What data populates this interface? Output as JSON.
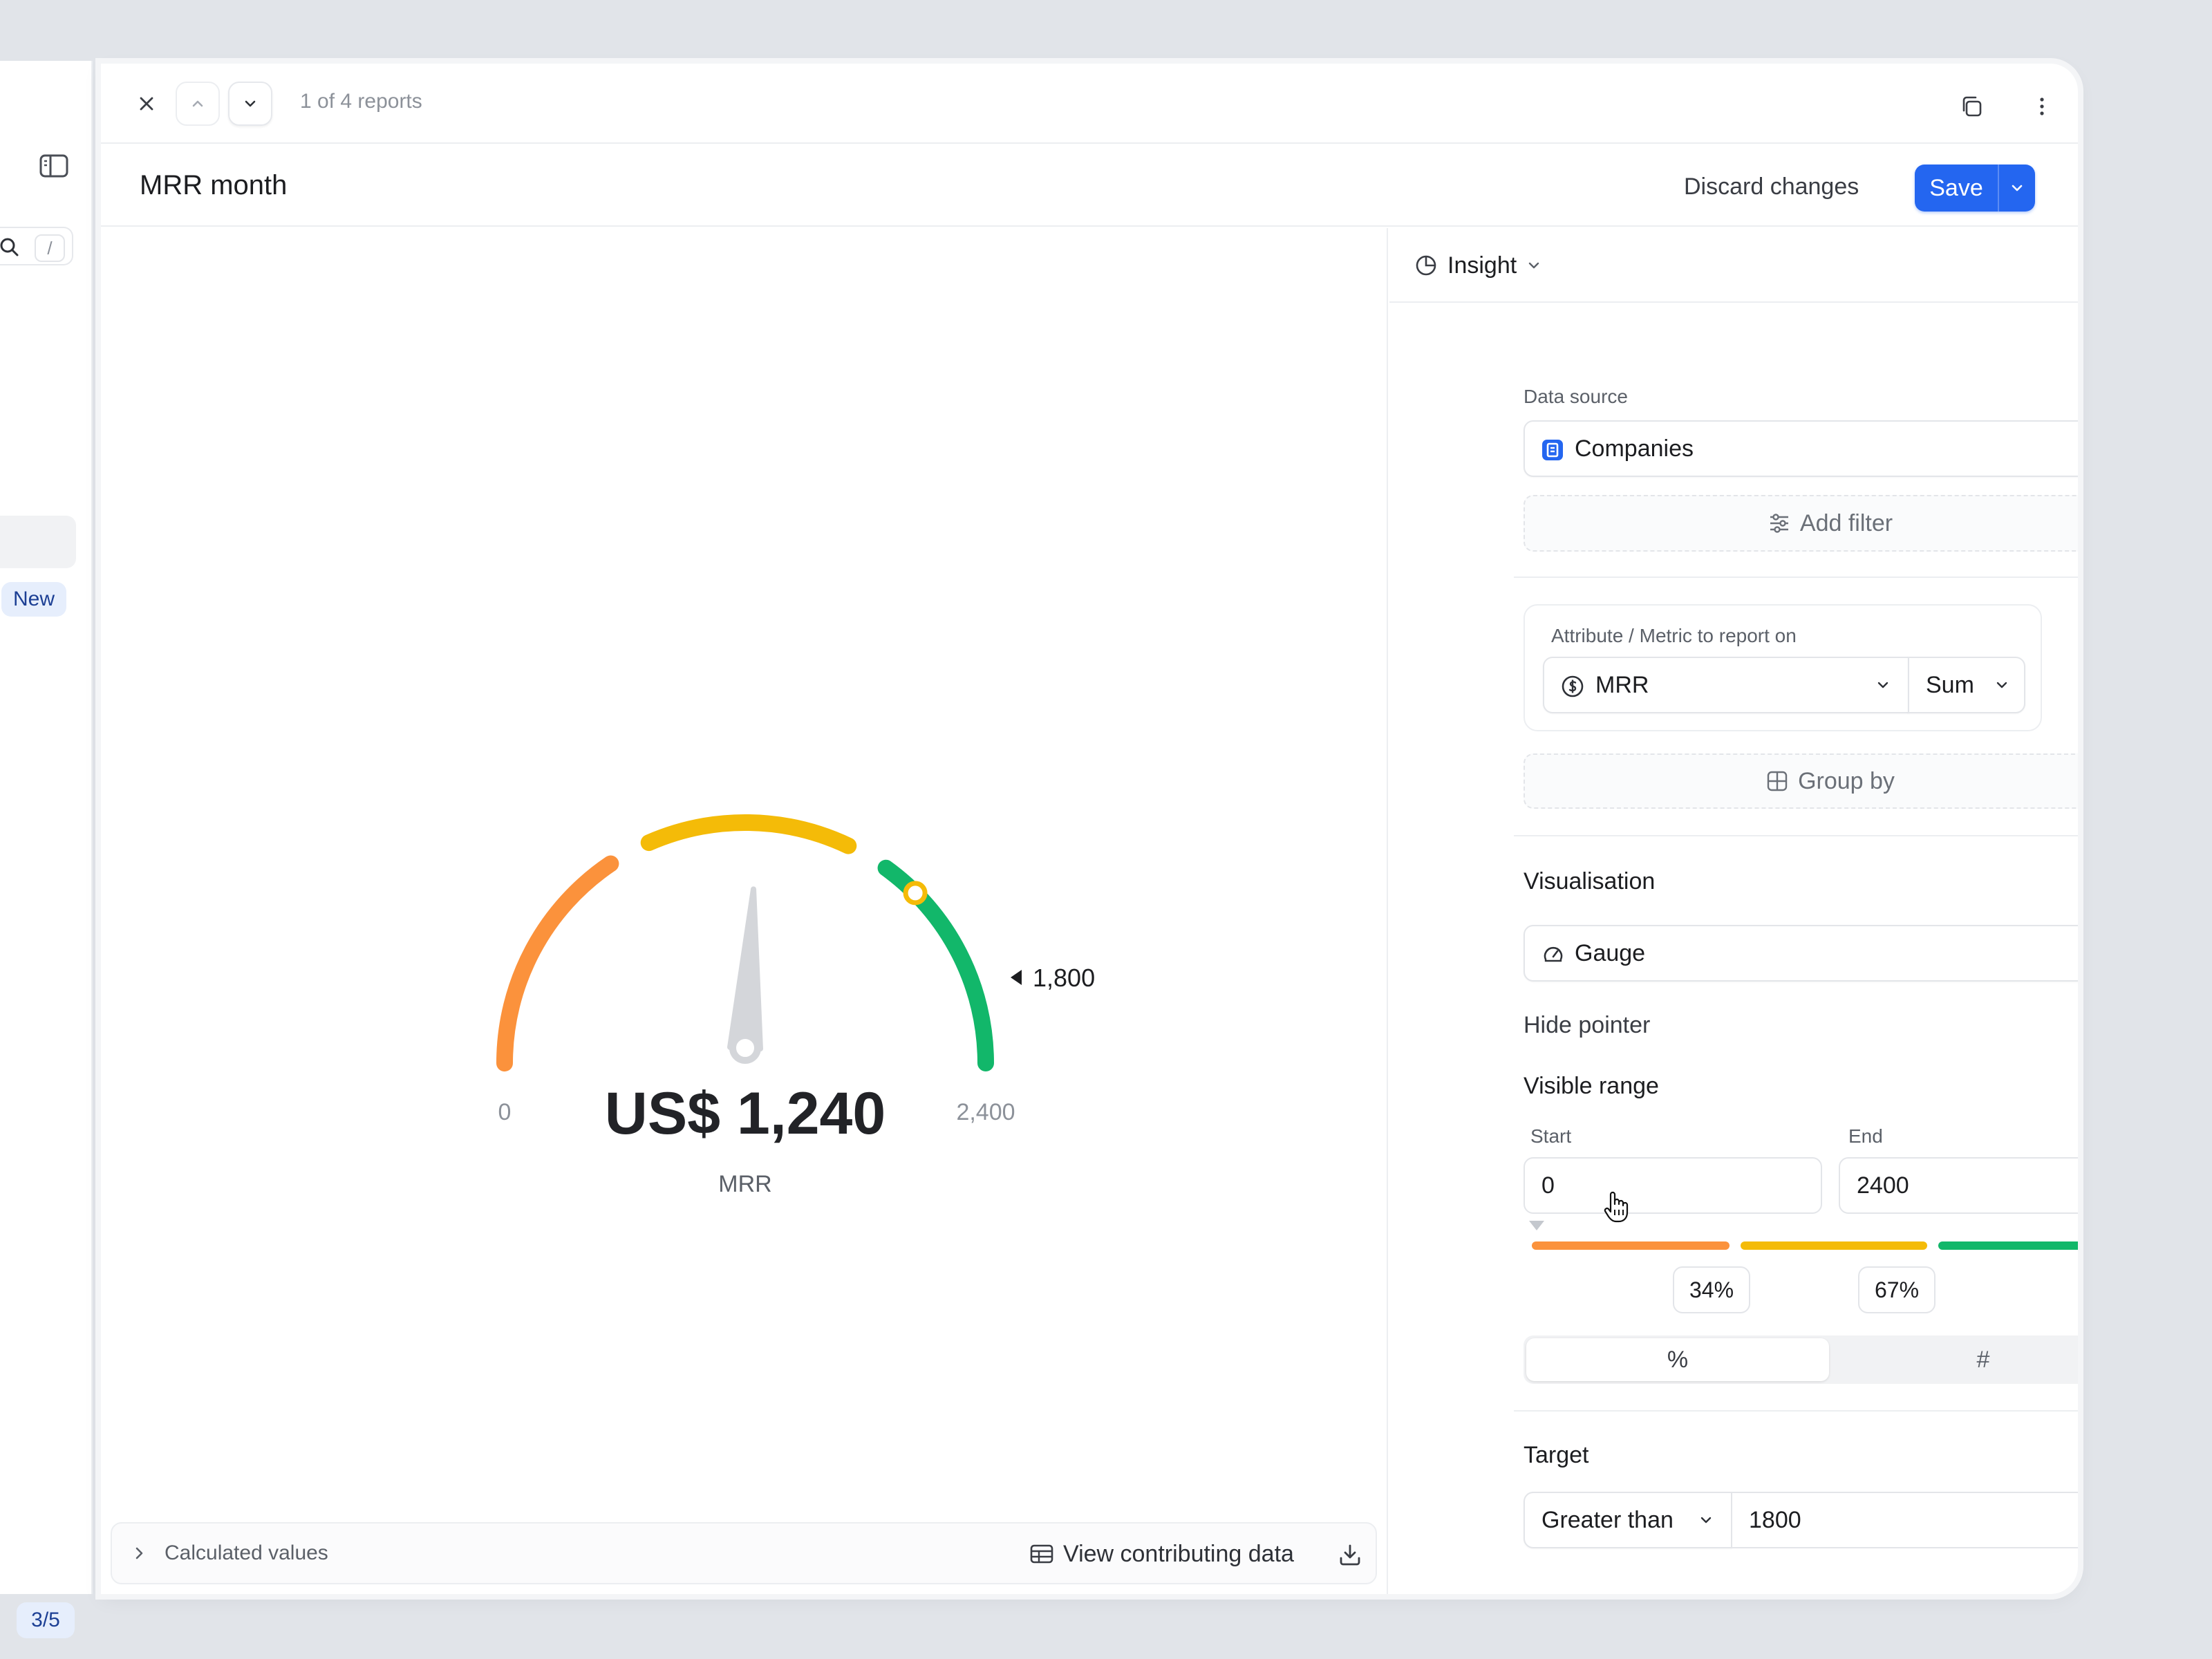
{
  "sidebar": {
    "search_shortcut": "/",
    "new_badge": "New",
    "pager": "3/5"
  },
  "topbar": {
    "report_count": "1 of 4 reports"
  },
  "header": {
    "title": "MRR month",
    "discard_label": "Discard changes",
    "save_label": "Save"
  },
  "gauge": {
    "value_display": "US$ 1,240",
    "metric_label": "MRR",
    "min_label": "0",
    "max_label": "2,400",
    "target_label": "1,800",
    "value": 1240,
    "min": 0,
    "max": 2400,
    "target": 1800,
    "thresholds_pct": [
      34,
      67
    ],
    "colors": {
      "low": "#fb923c",
      "mid": "#f4bb08",
      "high": "#12b76a",
      "needle": "#d4d6da"
    }
  },
  "footer": {
    "calculated_values": "Calculated values",
    "view_data": "View contributing data"
  },
  "panel": {
    "mode_label": "Insight",
    "data_source_label": "Data source",
    "data_source_value": "Companies",
    "add_filter": "Add filter",
    "metric_section_label": "Attribute / Metric to report on",
    "metric_value": "MRR",
    "aggregation_value": "Sum",
    "group_by": "Group by",
    "visualisation_title": "Visualisation",
    "visualisation_value": "Gauge",
    "hide_pointer_label": "Hide pointer",
    "hide_pointer_on": false,
    "visible_range_title": "Visible range",
    "start_label": "Start",
    "start_value": "0",
    "end_label": "End",
    "end_value": "2400",
    "threshold_1": "34%",
    "threshold_2": "67%",
    "unit_percent": "%",
    "unit_number": "#",
    "target_title": "Target",
    "target_on": true,
    "target_operator": "Greater than",
    "target_value": "1800"
  },
  "accent_color": "#2466f0"
}
